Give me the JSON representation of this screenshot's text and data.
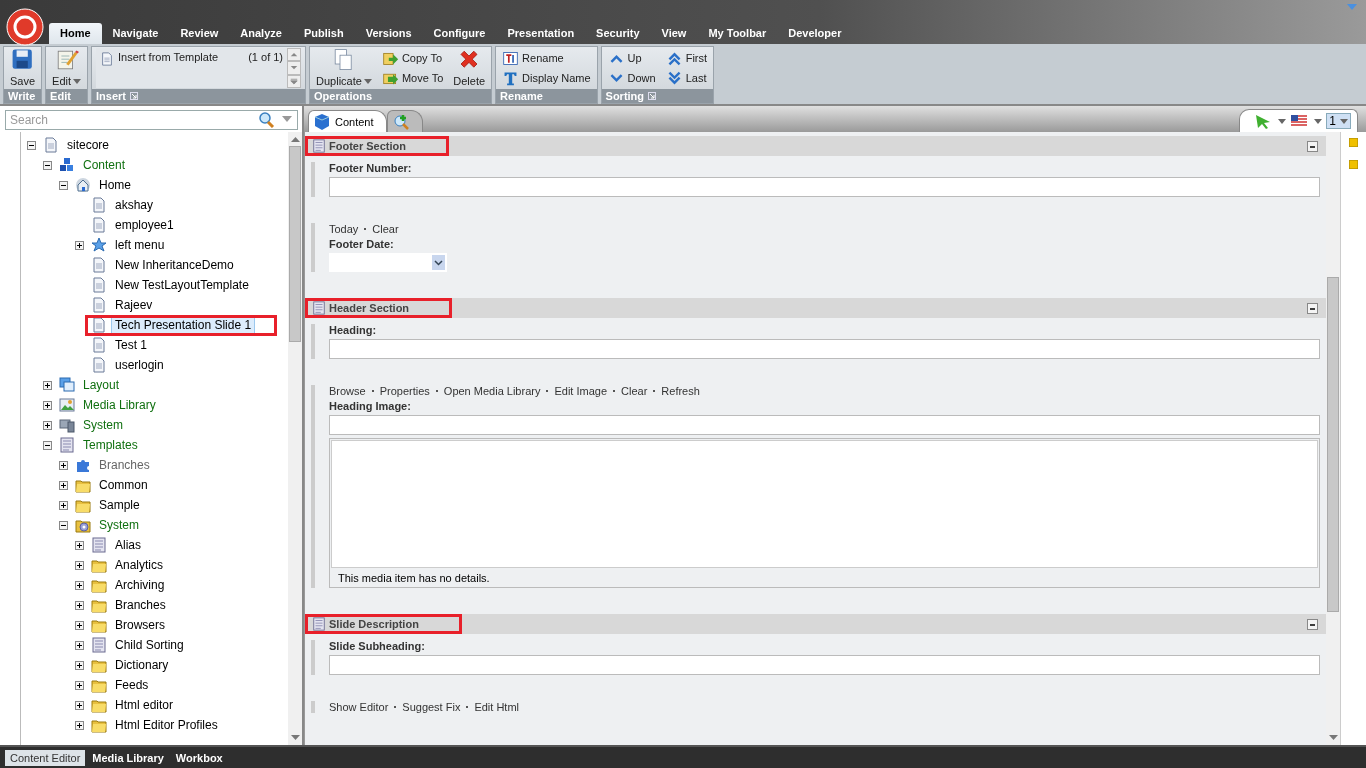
{
  "menu_tabs": [
    {
      "label": "Home",
      "selected": true
    },
    {
      "label": "Navigate",
      "selected": false
    },
    {
      "label": "Review",
      "selected": false
    },
    {
      "label": "Analyze",
      "selected": false
    },
    {
      "label": "Publish",
      "selected": false
    },
    {
      "label": "Versions",
      "selected": false
    },
    {
      "label": "Configure",
      "selected": false
    },
    {
      "label": "Presentation",
      "selected": false
    },
    {
      "label": "Security",
      "selected": false
    },
    {
      "label": "View",
      "selected": false
    },
    {
      "label": "My Toolbar",
      "selected": false
    },
    {
      "label": "Developer",
      "selected": false
    }
  ],
  "ribbon_groups": [
    {
      "label": "Write",
      "launcher": false,
      "controls": [
        {
          "kind": "save",
          "label": "Save",
          "dropdown": false
        }
      ]
    },
    {
      "label": "Edit",
      "launcher": false,
      "controls": [
        {
          "kind": "edit",
          "label": "Edit",
          "dropdown": true
        }
      ]
    },
    {
      "label": "Insert",
      "launcher": true,
      "controls": [
        {
          "kind": "gallery",
          "label": "Insert from Template",
          "count": "(1 of 1)"
        }
      ]
    },
    {
      "label": "Operations",
      "launcher": false,
      "controls": [
        {
          "kind": "duplicate",
          "label": "Duplicate",
          "dropdown": true
        },
        {
          "kind": "stack",
          "items": [
            {
              "kind": "copy-to",
              "label": "Copy To"
            },
            {
              "kind": "move-to",
              "label": "Move To"
            }
          ]
        },
        {
          "kind": "delete",
          "label": "Delete",
          "dropdown": false
        }
      ]
    },
    {
      "label": "Rename",
      "launcher": false,
      "controls": [
        {
          "kind": "stack",
          "items": [
            {
              "kind": "rename",
              "label": "Rename"
            },
            {
              "kind": "display-name",
              "label": "Display Name"
            }
          ]
        }
      ]
    },
    {
      "label": "Sorting",
      "launcher": true,
      "controls": [
        {
          "kind": "stack",
          "items": [
            {
              "kind": "up",
              "label": "Up"
            },
            {
              "kind": "down",
              "label": "Down"
            }
          ]
        },
        {
          "kind": "stack",
          "items": [
            {
              "kind": "first",
              "label": "First"
            },
            {
              "kind": "last",
              "label": "Last"
            }
          ]
        }
      ]
    }
  ],
  "search": {
    "placeholder": "Search"
  },
  "tree": [
    {
      "label": "sitecore",
      "kind": "document",
      "color": "#000000",
      "expanded": true,
      "selected": false,
      "highlighted": false,
      "children": [
        {
          "label": "Content",
          "kind": "cubes",
          "color": "#107010",
          "expanded": true,
          "selected": false,
          "highlighted": false,
          "children": [
            {
              "label": "Home",
              "kind": "house",
              "color": "#000000",
              "expanded": true,
              "selected": false,
              "highlighted": false,
              "children": [
                {
                  "label": "akshay",
                  "kind": "document",
                  "color": "#000000",
                  "selected": false,
                  "highlighted": false
                },
                {
                  "label": "employee1",
                  "kind": "document",
                  "color": "#000000",
                  "selected": false,
                  "highlighted": false
                },
                {
                  "label": "left menu",
                  "kind": "star",
                  "color": "#000000",
                  "expanded": false,
                  "selected": false,
                  "highlighted": false
                },
                {
                  "label": "New InheritanceDemo",
                  "kind": "document",
                  "color": "#000000",
                  "selected": false,
                  "highlighted": false
                },
                {
                  "label": "New TestLayoutTemplate",
                  "kind": "document",
                  "color": "#000000",
                  "selected": false,
                  "highlighted": false
                },
                {
                  "label": "Rajeev",
                  "kind": "document",
                  "color": "#000000",
                  "selected": false,
                  "highlighted": false
                },
                {
                  "label": "Tech Presentation Slide 1",
                  "kind": "document",
                  "color": "#000000",
                  "selected": true,
                  "highlighted": true
                },
                {
                  "label": "Test 1",
                  "kind": "document",
                  "color": "#000000",
                  "selected": false,
                  "highlighted": false
                },
                {
                  "label": "userlogin",
                  "kind": "document",
                  "color": "#000000",
                  "selected": false,
                  "highlighted": false
                }
              ]
            }
          ]
        },
        {
          "label": "Layout",
          "kind": "windows",
          "color": "#107010",
          "expanded": false,
          "selected": false,
          "highlighted": false
        },
        {
          "label": "Media Library",
          "kind": "image",
          "color": "#107010",
          "expanded": false,
          "selected": false,
          "highlighted": false
        },
        {
          "label": "System",
          "kind": "computer",
          "color": "#107010",
          "expanded": false,
          "selected": false,
          "highlighted": false
        },
        {
          "label": "Templates",
          "kind": "template",
          "color": "#107010",
          "expanded": true,
          "selected": false,
          "highlighted": false,
          "children": [
            {
              "label": "Branches",
              "kind": "puzzle",
              "color": "#666666",
              "expanded": false,
              "selected": false,
              "highlighted": false
            },
            {
              "label": "Common",
              "kind": "folder",
              "color": "#000000",
              "expanded": false,
              "selected": false,
              "highlighted": false
            },
            {
              "label": "Sample",
              "kind": "folder",
              "color": "#000000",
              "expanded": false,
              "selected": false,
              "highlighted": false
            },
            {
              "label": "System",
              "kind": "gear-folder",
              "color": "#107010",
              "expanded": true,
              "selected": false,
              "highlighted": false,
              "children": [
                {
                  "label": "Alias",
                  "kind": "template",
                  "color": "#000000",
                  "expanded": false,
                  "selected": false,
                  "highlighted": false
                },
                {
                  "label": "Analytics",
                  "kind": "folder",
                  "color": "#000000",
                  "expanded": false,
                  "selected": false,
                  "highlighted": false
                },
                {
                  "label": "Archiving",
                  "kind": "folder",
                  "color": "#000000",
                  "expanded": false,
                  "selected": false,
                  "highlighted": false
                },
                {
                  "label": "Branches",
                  "kind": "folder",
                  "color": "#000000",
                  "expanded": false,
                  "selected": false,
                  "highlighted": false
                },
                {
                  "label": "Browsers",
                  "kind": "folder",
                  "color": "#000000",
                  "expanded": false,
                  "selected": false,
                  "highlighted": false
                },
                {
                  "label": "Child Sorting",
                  "kind": "template",
                  "color": "#000000",
                  "expanded": false,
                  "selected": false,
                  "highlighted": false
                },
                {
                  "label": "Dictionary",
                  "kind": "folder",
                  "color": "#000000",
                  "expanded": false,
                  "selected": false,
                  "highlighted": false
                },
                {
                  "label": "Feeds",
                  "kind": "folder",
                  "color": "#000000",
                  "expanded": false,
                  "selected": false,
                  "highlighted": false
                },
                {
                  "label": "Html editor",
                  "kind": "folder",
                  "color": "#000000",
                  "expanded": false,
                  "selected": false,
                  "highlighted": false
                },
                {
                  "label": "Html Editor Profiles",
                  "kind": "folder",
                  "color": "#000000",
                  "expanded": false,
                  "selected": false,
                  "highlighted": false
                }
              ]
            }
          ]
        }
      ]
    }
  ],
  "editor_tabs": [
    {
      "kind": "labeled",
      "label": "Content",
      "selected": true
    },
    {
      "kind": "icon",
      "selected": false
    }
  ],
  "version": "1",
  "sections": [
    {
      "title": "Footer Section",
      "highlighted": true,
      "fields": [
        {
          "kind": "text",
          "label": "Footer Number:"
        },
        {
          "kind": "date",
          "label": "Footer Date:",
          "actions": [
            "Today",
            "Clear"
          ]
        }
      ]
    },
    {
      "title": "Header Section",
      "highlighted": true,
      "fields": [
        {
          "kind": "text",
          "label": "Heading:"
        },
        {
          "kind": "image",
          "label": "Heading Image:",
          "actions": [
            "Browse",
            "Properties",
            "Open Media Library",
            "Edit Image",
            "Clear",
            "Refresh"
          ],
          "details": "This media item has no details."
        }
      ]
    },
    {
      "title": "Slide Description",
      "highlighted": true,
      "fields": [
        {
          "kind": "text",
          "label": "Slide Subheading:"
        },
        {
          "kind": "rich",
          "actions": [
            "Show Editor",
            "Suggest Fix",
            "Edit Html"
          ]
        }
      ]
    }
  ],
  "bottom_tabs": [
    {
      "label": "Content Editor",
      "selected": true
    },
    {
      "label": "Media Library",
      "selected": false
    },
    {
      "label": "Workbox",
      "selected": false
    }
  ]
}
